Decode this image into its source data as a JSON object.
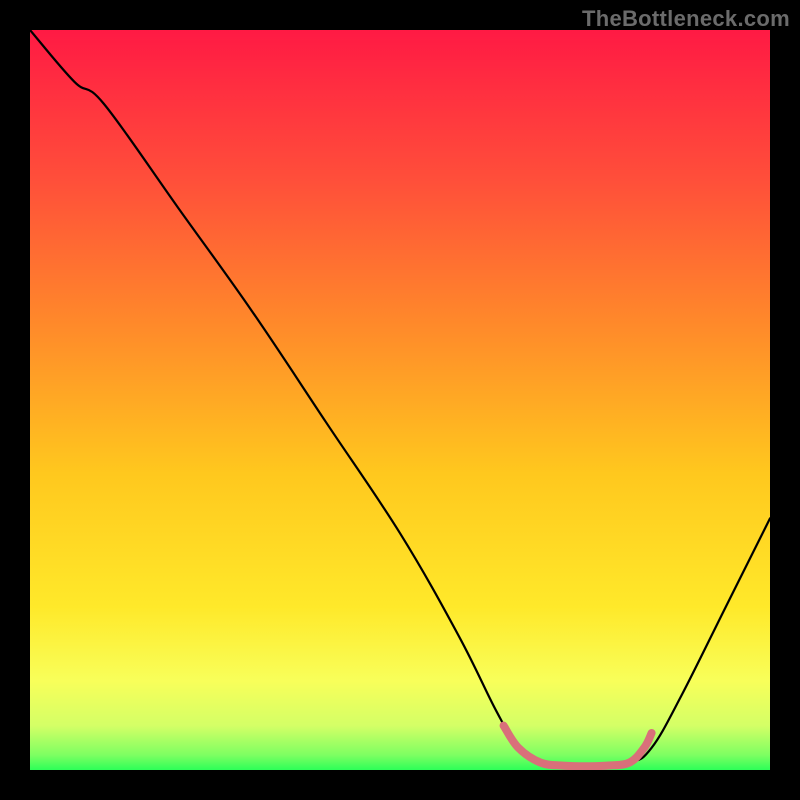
{
  "watermark": "TheBottleneck.com",
  "frame": {
    "outer_bg": "#000000"
  },
  "chart_data": {
    "type": "line",
    "title": "",
    "xlabel": "",
    "ylabel": "",
    "xlim": [
      0,
      100
    ],
    "ylim": [
      0,
      100
    ],
    "gradient_stops": [
      {
        "offset": 0,
        "color": "#ff1a44"
      },
      {
        "offset": 20,
        "color": "#ff4e3a"
      },
      {
        "offset": 40,
        "color": "#ff8a2a"
      },
      {
        "offset": 60,
        "color": "#ffc81e"
      },
      {
        "offset": 78,
        "color": "#ffe92a"
      },
      {
        "offset": 88,
        "color": "#f8ff5a"
      },
      {
        "offset": 94,
        "color": "#d4ff66"
      },
      {
        "offset": 98,
        "color": "#7dff62"
      },
      {
        "offset": 100,
        "color": "#2dff58"
      }
    ],
    "series": [
      {
        "name": "bottleneck-curve",
        "stroke": "#000000",
        "points": [
          {
            "x": 0,
            "y": 100
          },
          {
            "x": 6,
            "y": 93
          },
          {
            "x": 10,
            "y": 90
          },
          {
            "x": 20,
            "y": 76
          },
          {
            "x": 30,
            "y": 62
          },
          {
            "x": 40,
            "y": 47
          },
          {
            "x": 50,
            "y": 32
          },
          {
            "x": 58,
            "y": 18
          },
          {
            "x": 63,
            "y": 8
          },
          {
            "x": 66,
            "y": 3
          },
          {
            "x": 69,
            "y": 1
          },
          {
            "x": 75,
            "y": 0.5
          },
          {
            "x": 81,
            "y": 1
          },
          {
            "x": 84,
            "y": 3
          },
          {
            "x": 88,
            "y": 10
          },
          {
            "x": 94,
            "y": 22
          },
          {
            "x": 100,
            "y": 34
          }
        ]
      },
      {
        "name": "trough-marker",
        "stroke": "#d9707a",
        "points": [
          {
            "x": 64,
            "y": 6
          },
          {
            "x": 66,
            "y": 3
          },
          {
            "x": 69,
            "y": 1
          },
          {
            "x": 72,
            "y": 0.6
          },
          {
            "x": 75,
            "y": 0.5
          },
          {
            "x": 78,
            "y": 0.6
          },
          {
            "x": 81,
            "y": 1
          },
          {
            "x": 83,
            "y": 3
          },
          {
            "x": 84,
            "y": 5
          }
        ]
      }
    ]
  }
}
